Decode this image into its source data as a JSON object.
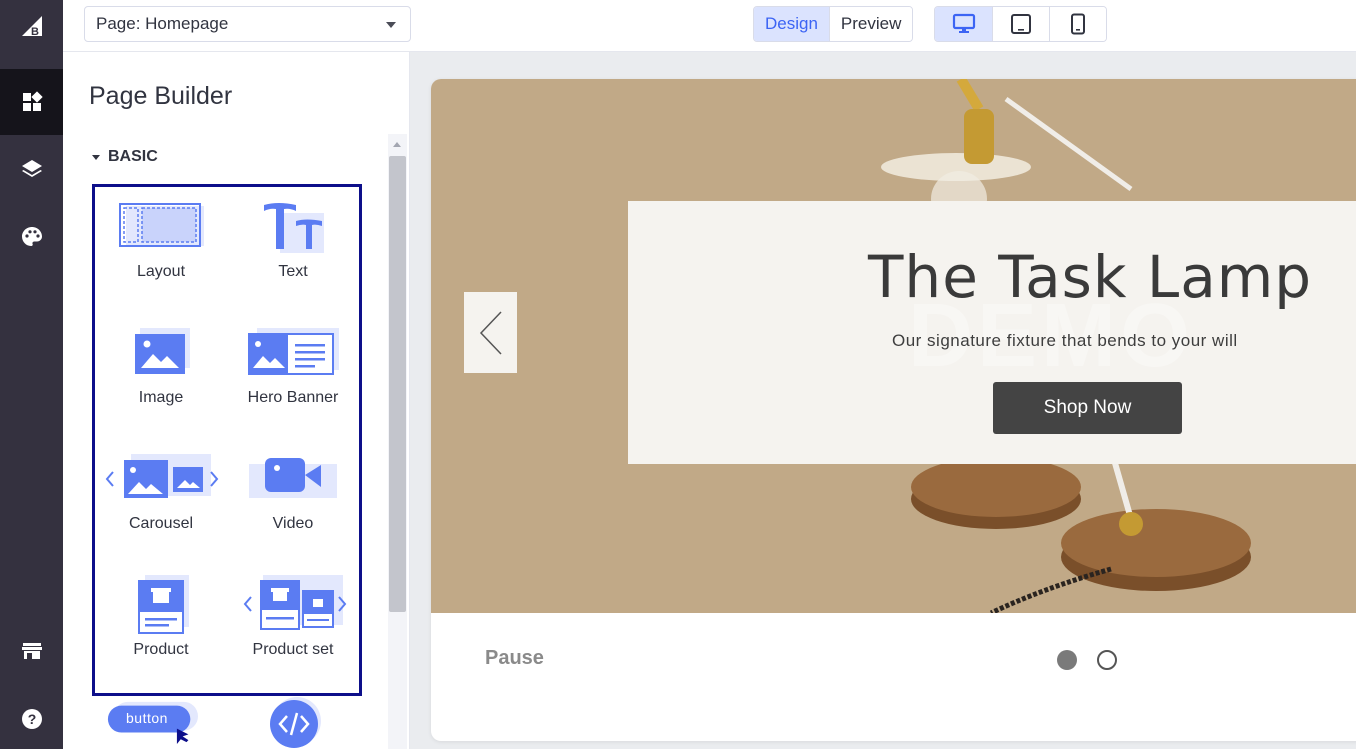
{
  "topbar": {
    "page_select": "Page: Homepage",
    "view_modes": [
      "Design",
      "Preview"
    ],
    "active_view": "Design",
    "device_icons": [
      "desktop-icon",
      "tablet-icon",
      "mobile-icon"
    ]
  },
  "rail": {
    "icons": [
      "bigcommerce-logo",
      "widgets-icon",
      "layers-icon",
      "palette-icon",
      "storefront-icon",
      "help-icon"
    ]
  },
  "sidebar": {
    "title": "Page Builder",
    "section": "BASIC",
    "widgets": [
      {
        "label": "Layout",
        "icon": "layout-icon"
      },
      {
        "label": "Text",
        "icon": "text-icon"
      },
      {
        "label": "Image",
        "icon": "image-icon"
      },
      {
        "label": "Hero Banner",
        "icon": "hero-banner-icon"
      },
      {
        "label": "Carousel",
        "icon": "carousel-icon"
      },
      {
        "label": "Video",
        "icon": "video-icon"
      },
      {
        "label": "Product",
        "icon": "product-icon"
      },
      {
        "label": "Product set",
        "icon": "product-set-icon"
      }
    ],
    "extra": {
      "button_text": "button",
      "html_icon": "code-icon"
    }
  },
  "preview": {
    "hero_title": "The Task Lamp",
    "hero_subtitle": "Our signature fixture that bends to your will",
    "hero_button": "Shop Now",
    "watermark": "DEMO",
    "pause": "Pause",
    "slide_count": 2,
    "active_slide": 1
  },
  "colors": {
    "rail": "#34313f",
    "accent": "#3c64f4",
    "widget_icon": "#5b7cf2",
    "selection_border": "#0d0f8a",
    "hero_bg": "#c1a987"
  }
}
